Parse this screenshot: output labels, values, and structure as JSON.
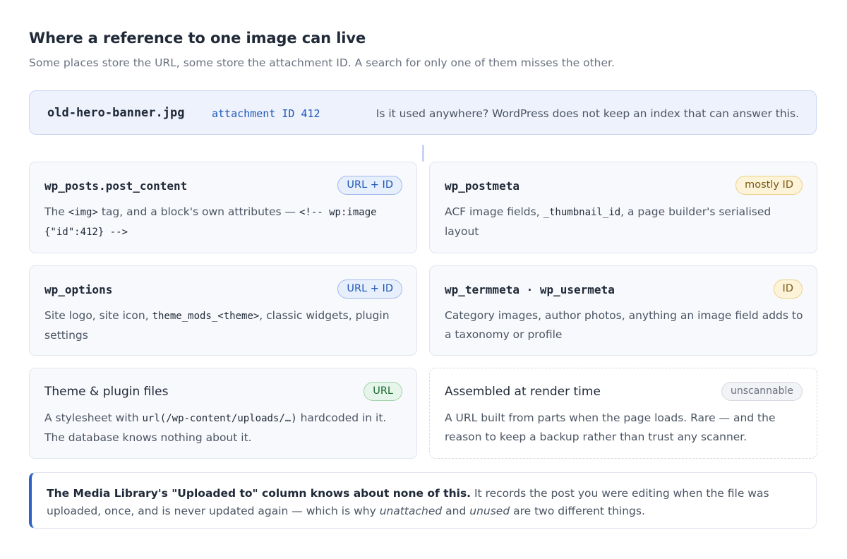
{
  "header": {
    "title": "Where a reference to one image can live",
    "subtitle": "Some places store the URL, some store the attachment ID. A search for only one of them misses the other."
  },
  "file": {
    "name": "old-hero-banner.jpg",
    "attachment": "attachment ID 412",
    "question": "Is it used anywhere? WordPress does not keep an index that can answer this."
  },
  "cards": [
    {
      "title": "wp_posts.post_content",
      "badge": "URL + ID",
      "body": {
        "t1": "The ",
        "c1": "<img>",
        "t2": " tag, and a block's own attributes — ",
        "c2": "<!-- wp:image {\"id\":412} -->"
      }
    },
    {
      "title": "wp_postmeta",
      "badge": "mostly ID",
      "body": {
        "t1": "ACF image fields, ",
        "c1": "_thumbnail_id",
        "t2": ", a page builder's serialised layout"
      }
    },
    {
      "title": "wp_options",
      "badge": "URL + ID",
      "body": {
        "t1": "Site logo, site icon, ",
        "c1": "theme_mods_<theme>",
        "t2": ", classic widgets, plugin settings"
      }
    },
    {
      "title": "wp_termmeta · wp_usermeta",
      "badge": "ID",
      "body": {
        "t1": "Category images, author photos, anything an image field adds to a taxonomy or profile"
      }
    },
    {
      "title": "Theme & plugin files",
      "badge": "URL",
      "body": {
        "t1": "A stylesheet with ",
        "c1": "url(/wp-content/uploads/…)",
        "t2": " hardcoded in it. The database knows nothing about it."
      }
    },
    {
      "title": "Assembled at render time",
      "badge": "unscannable",
      "body": {
        "t1": "A URL built from parts when the page loads. Rare — and the reason to keep a backup rather than trust any scanner."
      }
    }
  ],
  "note": {
    "bold": "The Media Library's \"Uploaded to\" column knows about none of this.",
    "t1": " It records the post you were editing when the file was uploaded, once, and is never updated again — which is why ",
    "em1": "unattached",
    "t2": " and ",
    "em2": "unused",
    "t3": " are two different things."
  },
  "colors": {
    "accent": "#2f62c4",
    "badge_blue": "#1d56b5",
    "badge_amber": "#7a5a12",
    "badge_green": "#1d6b33",
    "badge_gray": "#6b7280"
  }
}
